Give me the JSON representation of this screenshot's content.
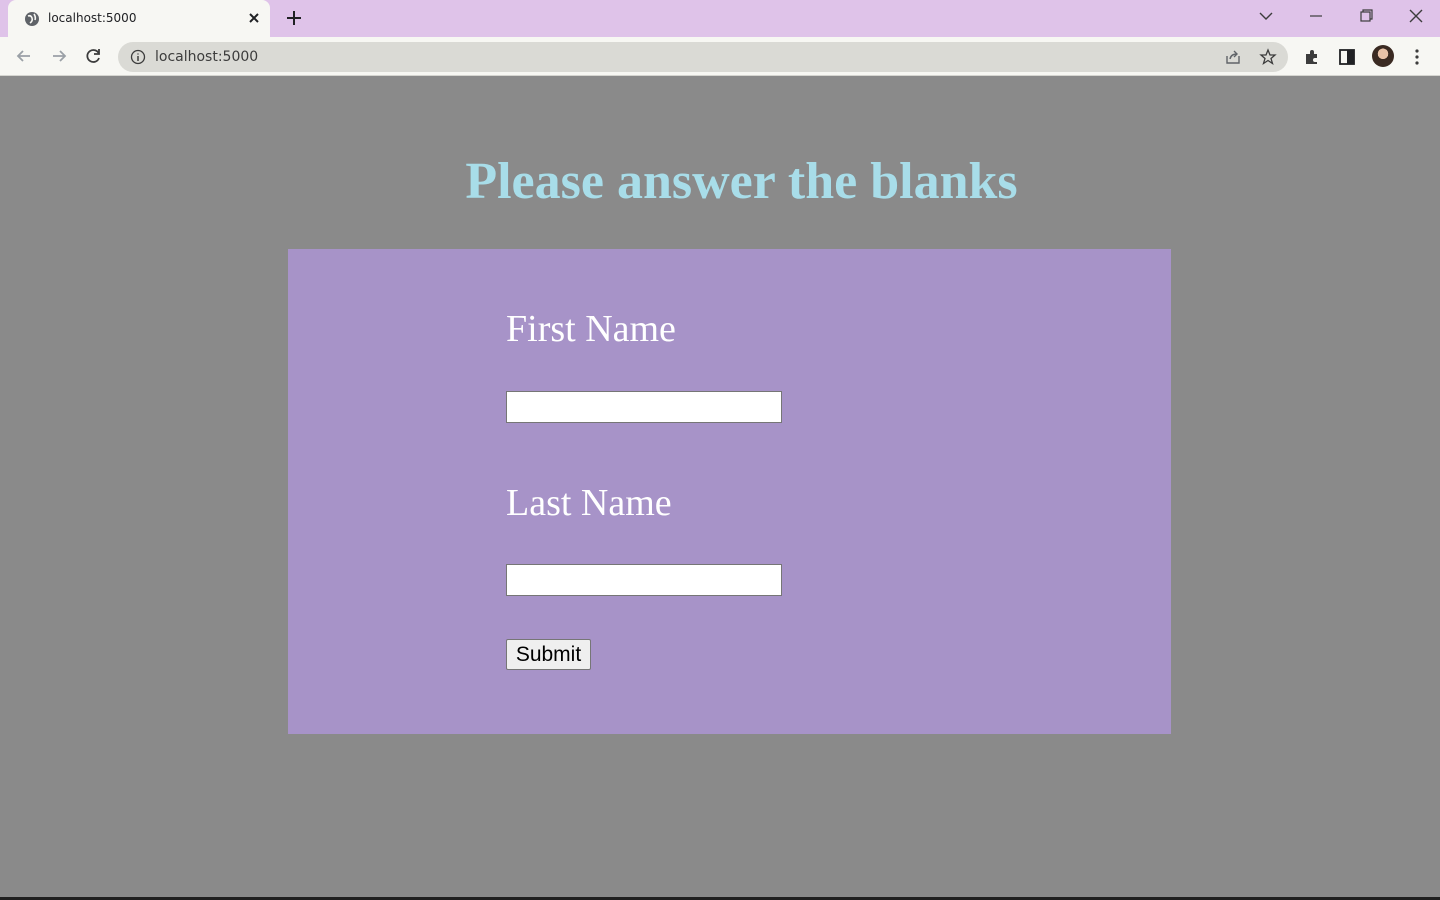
{
  "browser": {
    "tab_title": "localhost:5000",
    "url": "localhost:5000"
  },
  "page": {
    "heading": "Please answer the blanks",
    "form": {
      "first_name_label": "First Name",
      "first_name_value": "",
      "last_name_label": "Last Name",
      "last_name_value": "",
      "submit_label": "Submit"
    }
  },
  "colors": {
    "page_background": "#8a8a8a",
    "card_background": "#a793c8",
    "heading_color": "#a8dde9",
    "tabbar": "#dfc3e9"
  }
}
